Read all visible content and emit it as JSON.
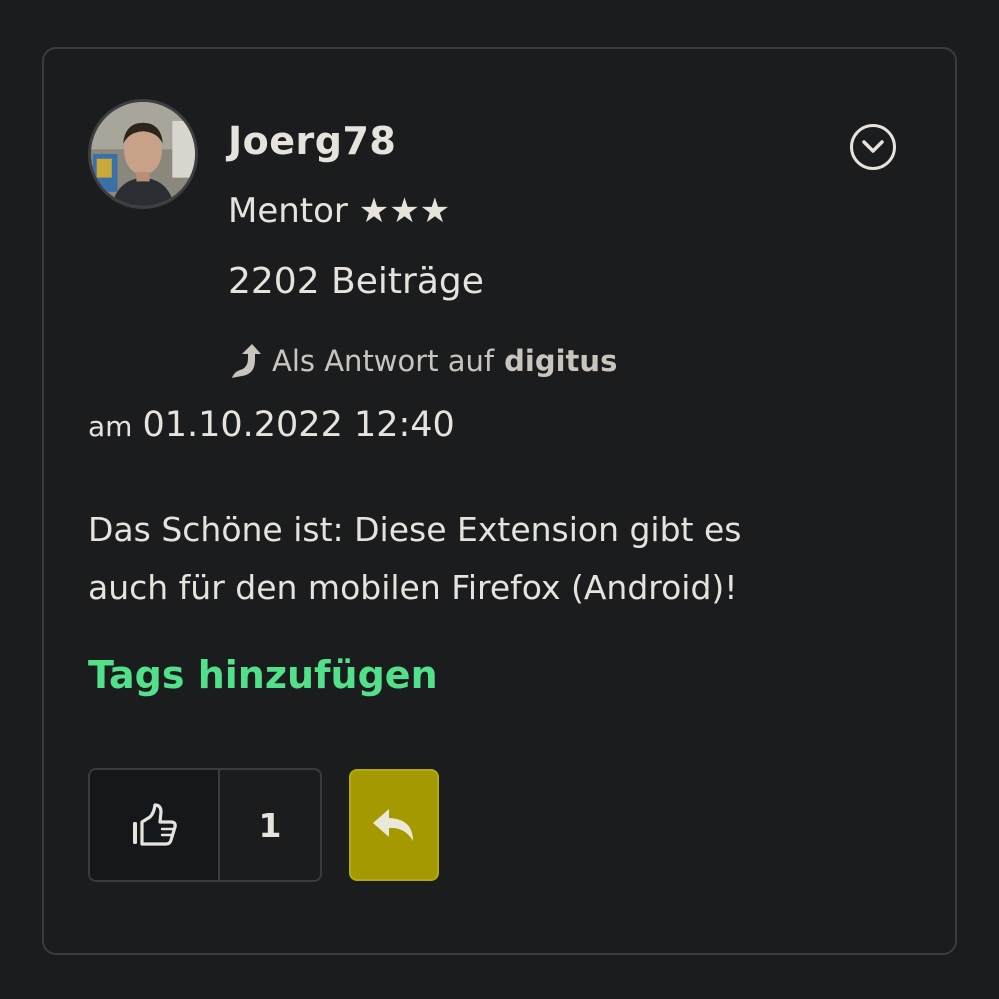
{
  "post": {
    "author": "Joerg78",
    "rank": "Mentor ★★★",
    "post_count": "2202 Beiträge",
    "reply_prefix": "Als Antwort auf",
    "reply_to": "digitus",
    "date_prefix": "am",
    "datetime": "01.10.2022 12:40",
    "body_line1": "Das Schöne ist: Diese Extension gibt es",
    "body_line2": "auch für den mobilen Firefox (Android)!",
    "tags_link": "Tags hinzufügen",
    "kudos_count": "1"
  },
  "icons": {
    "menu": "chevron-down-circle-icon",
    "reply_ref": "curved-arrow-up-icon",
    "like": "thumbs-up-icon",
    "reply": "reply-arrow-icon"
  },
  "colors": {
    "background": "#1b1c1e",
    "card_border": "#3a3b3e",
    "text": "#e6e3dc",
    "tags_link": "#53e08a",
    "reply_button": "#a49a00"
  }
}
